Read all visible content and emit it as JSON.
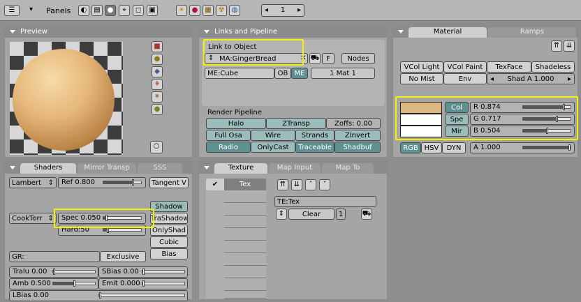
{
  "header": {
    "panels_label": "Panels",
    "frame": "1",
    "colors": {
      "bg": "#b6b6b6"
    }
  },
  "preview": {
    "title": "Preview"
  },
  "links": {
    "title": "Links and Pipeline",
    "link_to_object": "Link to Object",
    "material_name": "MA:GingerBread",
    "f_label": "F",
    "nodes_label": "Nodes",
    "mesh_name": "ME:Cube",
    "ob_label": "OB",
    "me_label": "ME",
    "mat_index": "1 Mat 1",
    "render_pipeline": "Render Pipeline",
    "halo": "Halo",
    "ztransp": "ZTransp",
    "zoffs": "Zoffs: 0.00",
    "full_osa": "Full Osa",
    "wire": "Wire",
    "strands": "Strands",
    "zinvert": "ZInvert",
    "radio": "Radio",
    "onlycast": "OnlyCast",
    "traceable": "Traceable",
    "shadbuf": "Shadbuf"
  },
  "material": {
    "tab_material": "Material",
    "tab_ramps": "Ramps",
    "vcol_light": "VCol Light",
    "vcol_paint": "VCol Paint",
    "texface": "TexFace",
    "shadeless": "Shadeless",
    "no_mist": "No Mist",
    "env": "Env",
    "shad_a": "Shad A 1.000",
    "col": "Col",
    "spe": "Spe",
    "mir": "Mir",
    "r": "R 0.874",
    "g": "G 0.717",
    "b": "B 0.504",
    "rgb": "RGB",
    "hsv": "HSV",
    "dyn": "DYN",
    "a": "A 1.000",
    "r_level": 0.874,
    "g_level": 0.717,
    "b_level": 0.504,
    "a_level": 1.0,
    "col_color": "#dfb780",
    "spe_color": "#ffffff",
    "mir_color": "#ffffff"
  },
  "shaders": {
    "tab_shaders": "Shaders",
    "tab_mirror": "Mirror Transp",
    "tab_sss": "SSS",
    "diffuse": "Lambert",
    "ref": "Ref  0.800",
    "tangent": "Tangent V",
    "specular": "CookTorr",
    "spec": "Spec 0.050",
    "hard": "Hard:50",
    "shadow": "Shadow",
    "trashadow": "TraShadow",
    "onlyshad": "OnlyShad",
    "cubic": "Cubic",
    "bias": "Bias",
    "gr": "GR:",
    "exclusive": "Exclusive",
    "tralu": "Tralu 0.00",
    "sbias": "SBias 0.00",
    "amb": "Amb 0.500",
    "emit": "Emit 0.000",
    "lbias": "LBias 0.00",
    "ref_level": 0.8,
    "spec_level": 0.05,
    "hard_level": 0.1,
    "amb_level": 0.5
  },
  "texture": {
    "tab_texture": "Texture",
    "tab_mapinput": "Map Input",
    "tab_mapto": "Map To",
    "tex_slot": "Tex",
    "te_name": "TE:Tex",
    "clear": "Clear",
    "users": "1"
  }
}
